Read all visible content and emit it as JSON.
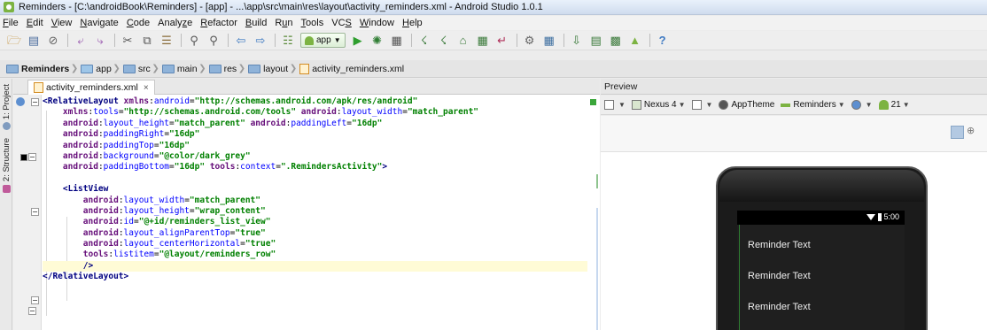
{
  "window": {
    "title": "Reminders - [C:\\androidBook\\Reminders] - [app] - ...\\app\\src\\main\\res\\layout\\activity_reminders.xml - Android Studio 1.0.1"
  },
  "menu": [
    {
      "label": "File",
      "u": "F",
      "rest": "ile"
    },
    {
      "label": "Edit",
      "u": "E",
      "rest": "dit"
    },
    {
      "label": "View",
      "u": "V",
      "rest": "iew"
    },
    {
      "label": "Navigate",
      "u": "N",
      "rest": "avigate"
    },
    {
      "label": "Code",
      "u": "C",
      "rest": "ode"
    },
    {
      "label": "Analyze",
      "pre": "Analy",
      "u": "z",
      "rest": "e"
    },
    {
      "label": "Refactor",
      "u": "R",
      "rest": "efactor"
    },
    {
      "label": "Build",
      "u": "B",
      "rest": "uild"
    },
    {
      "label": "Run",
      "pre": "R",
      "u": "u",
      "rest": "n"
    },
    {
      "label": "Tools",
      "u": "T",
      "rest": "ools"
    },
    {
      "label": "VCS",
      "pre": "VC",
      "u": "S",
      "rest": ""
    },
    {
      "label": "Window",
      "u": "W",
      "rest": "indow"
    },
    {
      "label": "Help",
      "u": "H",
      "rest": "elp"
    }
  ],
  "toolbar": {
    "run_config": "app",
    "help_glyph": "?"
  },
  "breadcrumbs": [
    "Reminders",
    "app",
    "src",
    "main",
    "res",
    "layout",
    "activity_reminders.xml"
  ],
  "sidebar": {
    "project": "1: Project",
    "structure": "2: Structure"
  },
  "editor": {
    "tab_label": "activity_reminders.xml",
    "tab_close": "×",
    "lines": [
      "<RelativeLayout xmlns:android=\"http://schemas.android.com/apk/res/android\"",
      "    xmlns:tools=\"http://schemas.android.com/tools\" android:layout_width=\"match_parent\"",
      "    android:layout_height=\"match_parent\" android:paddingLeft=\"16dp\"",
      "    android:paddingRight=\"16dp\"",
      "    android:paddingTop=\"16dp\"",
      "    android:background=\"@color/dark_grey\"",
      "    android:paddingBottom=\"16dp\" tools:context=\".RemindersActivity\">",
      "",
      "    <ListView",
      "        android:layout_width=\"match_parent\"",
      "        android:layout_height=\"wrap_content\"",
      "        android:id=\"@+id/reminders_list_view\"",
      "        android:layout_alignParentTop=\"true\"",
      "        android:layout_centerHorizontal=\"true\"",
      "        tools:listitem=\"@layout/reminders_row\"",
      "        />",
      "</RelativeLayout>"
    ]
  },
  "preview": {
    "header": "Preview",
    "device": "Nexus 4",
    "theme": "AppTheme",
    "activity": "Reminders",
    "api": "21",
    "status_time": "5:00",
    "items": [
      "Reminder Text",
      "Reminder Text",
      "Reminder Text"
    ]
  },
  "colors": {
    "dark_grey_swatch": "#1f1f1f",
    "android_green": "#7cb342"
  }
}
